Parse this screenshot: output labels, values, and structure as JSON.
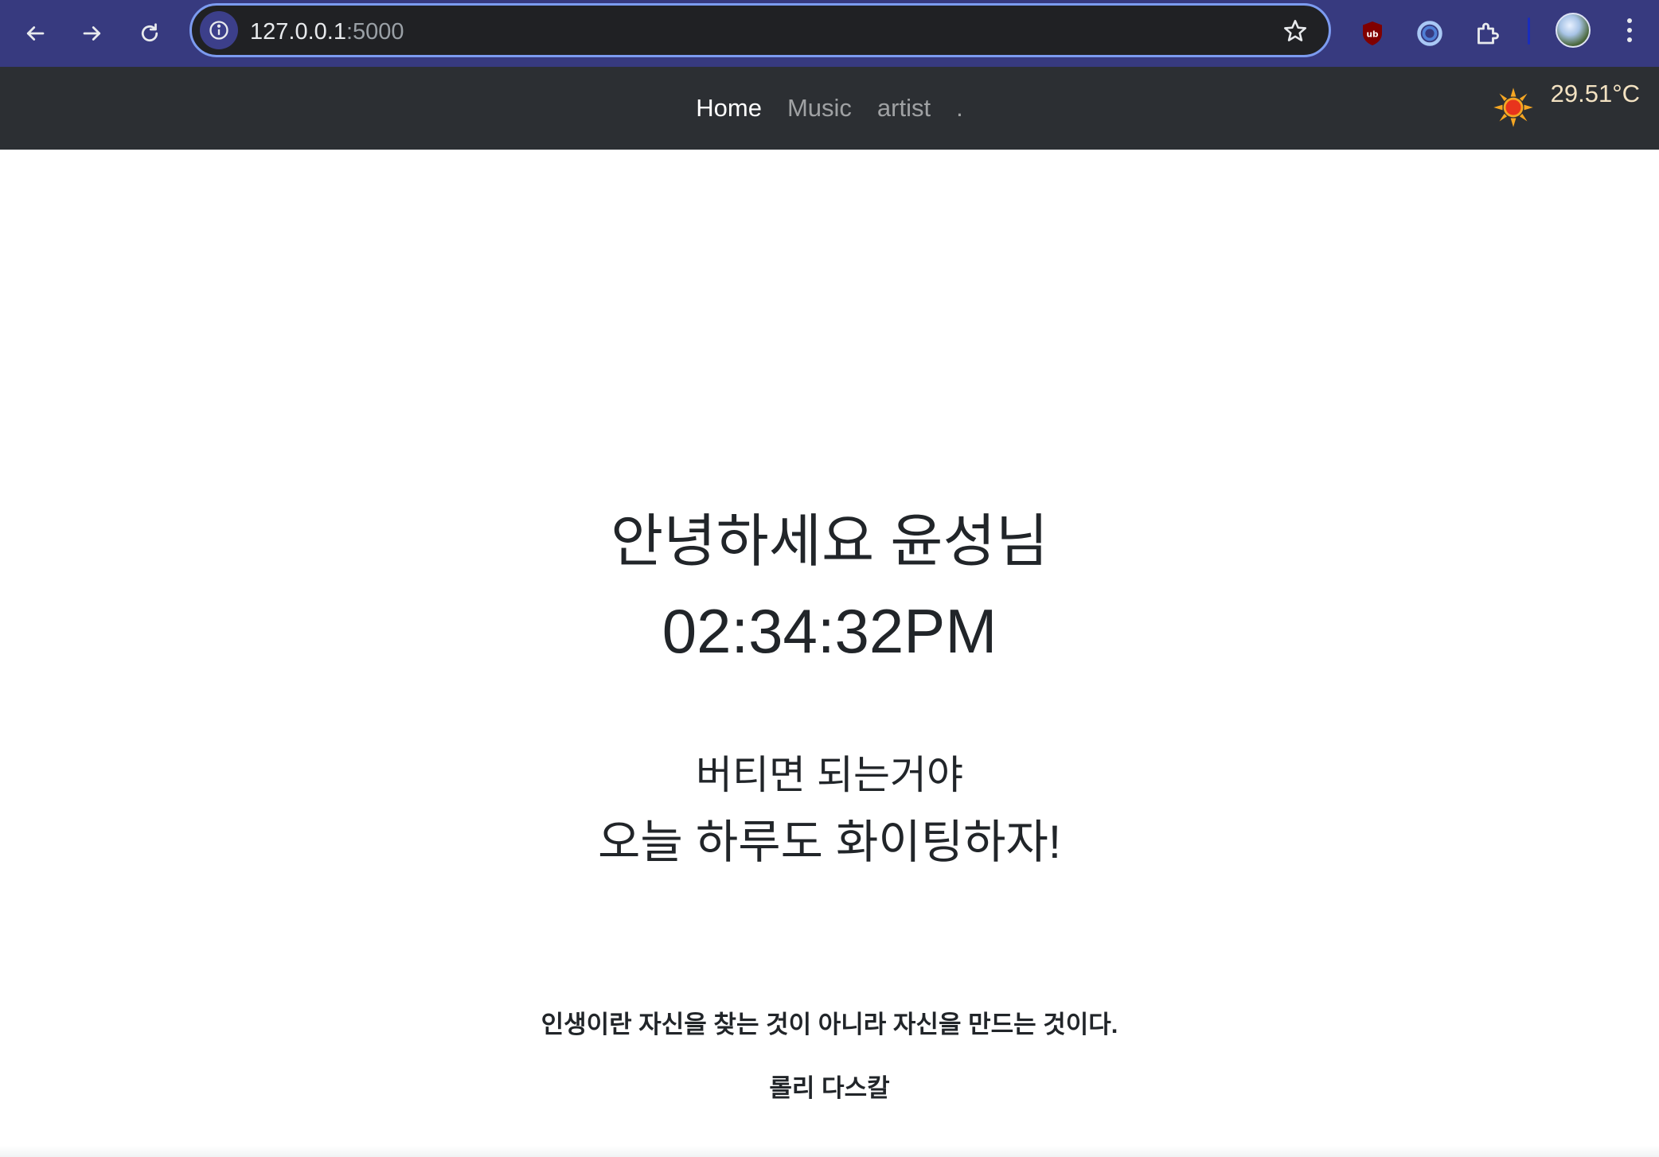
{
  "browser": {
    "url_host": "127.0.0.1",
    "url_port": ":5000",
    "back_icon": "arrow-left-icon",
    "forward_icon": "arrow-right-icon",
    "reload_icon": "reload-icon",
    "site_info_icon": "info-icon",
    "bookmark_icon": "star-icon",
    "extensions": [
      "ublock-icon",
      "circle-extension-icon",
      "puzzle-extensions-icon"
    ],
    "accent_color": "#373a7f"
  },
  "navbar": {
    "links": [
      {
        "label": "Home",
        "active": true
      },
      {
        "label": "Music",
        "active": false
      },
      {
        "label": "artist",
        "active": false
      },
      {
        "label": ".",
        "active": false
      }
    ],
    "weather_icon": "sun-icon",
    "temperature": "29.51°C",
    "background": "#2c2f33"
  },
  "main": {
    "greeting": "안녕하세요 윤성님",
    "clock": "02:34:32PM",
    "message_line1": "버티면 되는거야",
    "message_line2": "오늘 하루도 화이팅하자!",
    "quote": "인생이란 자신을 찾는 것이 아니라 자신을 만드는 것이다.",
    "quote_author": "롤리 다스칼"
  }
}
